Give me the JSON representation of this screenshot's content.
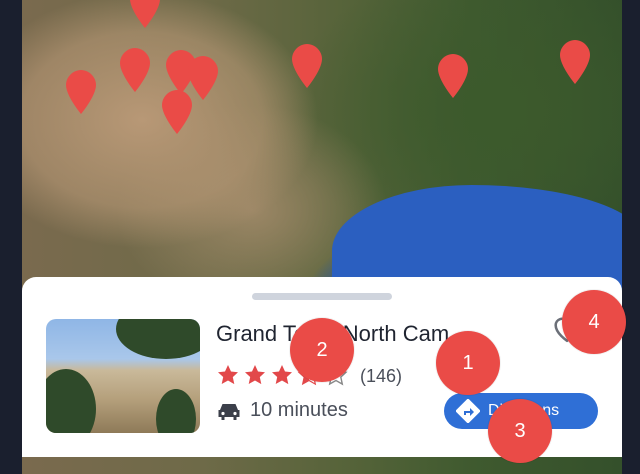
{
  "map": {
    "pins": [
      {
        "name": "pin-1"
      },
      {
        "name": "pin-2"
      },
      {
        "name": "pin-3"
      },
      {
        "name": "pin-4"
      },
      {
        "name": "pin-5"
      },
      {
        "name": "pin-6"
      },
      {
        "name": "pin-7"
      },
      {
        "name": "pin-8"
      },
      {
        "name": "pin-9"
      }
    ],
    "pin_color": "#ea4b47"
  },
  "card": {
    "title": "Grand Teton North Cam...",
    "rating": 3.5,
    "review_count": "(146)",
    "travel_time": "10 minutes",
    "directions_label": "Directions",
    "accent": "#2f6fd6"
  },
  "markers": [
    "1",
    "2",
    "3",
    "4"
  ],
  "marker_color": "#ea4b47"
}
